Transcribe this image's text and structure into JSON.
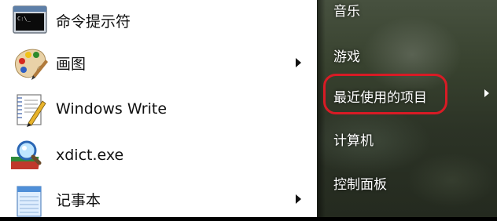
{
  "left_pane": {
    "items": [
      {
        "label": "命令提示符",
        "icon": "command-prompt-icon",
        "has_submenu": false
      },
      {
        "label": "画图",
        "icon": "paint-icon",
        "has_submenu": true
      },
      {
        "label": "Windows Write",
        "icon": "write-icon",
        "has_submenu": false
      },
      {
        "label": "xdict.exe",
        "icon": "xdict-icon",
        "has_submenu": false
      },
      {
        "label": "记事本",
        "icon": "notepad-icon",
        "has_submenu": true
      }
    ]
  },
  "right_pane": {
    "items": [
      {
        "label": "音乐",
        "has_submenu": false
      },
      {
        "label": "游戏",
        "has_submenu": false
      },
      {
        "label": "最近使用的项目",
        "has_submenu": true,
        "highlighted": true
      },
      {
        "label": "计算机",
        "has_submenu": false
      },
      {
        "label": "控制面板",
        "has_submenu": false
      }
    ]
  },
  "colors": {
    "highlight_border": "#d81b25",
    "right_pane_bg": "#38422f",
    "left_pane_bg": "#ffffff"
  }
}
